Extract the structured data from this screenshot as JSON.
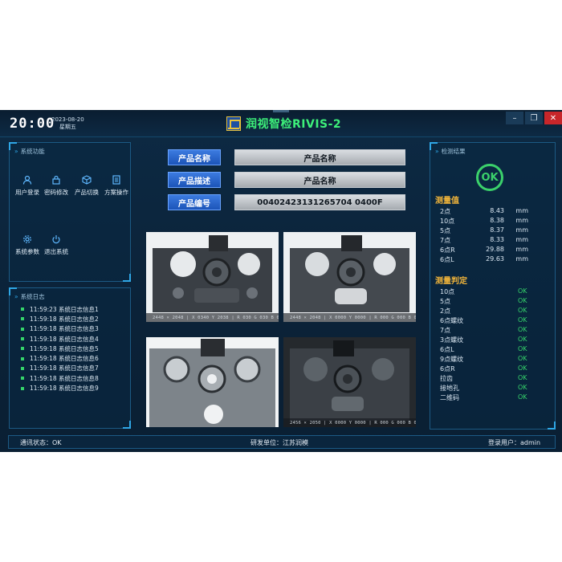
{
  "header": {
    "clock": "20:00",
    "date": "2023-08-20",
    "weekday": "星期五",
    "title": "润视智检RIVIS-2",
    "window_buttons": [
      "minimize-icon",
      "restore-icon",
      "close-icon"
    ]
  },
  "functions": {
    "title": "系统功能",
    "items": [
      {
        "label": "用户登录",
        "icon": "user-icon"
      },
      {
        "label": "密码修改",
        "icon": "lock-icon"
      },
      {
        "label": "产品切换",
        "icon": "cube-icon"
      },
      {
        "label": "方案操作",
        "icon": "document-icon"
      },
      {
        "label": "系统参数",
        "icon": "gear-icon"
      },
      {
        "label": "退出系统",
        "icon": "power-icon"
      }
    ]
  },
  "log": {
    "title": "系统日志",
    "entries": [
      {
        "time": "11:59:23",
        "text": "系统日志信息1"
      },
      {
        "time": "11:59:18",
        "text": "系统日志信息2"
      },
      {
        "time": "11:59:18",
        "text": "系统日志信息3"
      },
      {
        "time": "11:59:18",
        "text": "系统日志信息4"
      },
      {
        "time": "11:59:18",
        "text": "系统日志信息5"
      },
      {
        "time": "11:59:18",
        "text": "系统日志信息6"
      },
      {
        "time": "11:59:18",
        "text": "系统日志信息7"
      },
      {
        "time": "11:59:18",
        "text": "系统日志信息8"
      },
      {
        "time": "11:59:18",
        "text": "系统日志信息9"
      }
    ]
  },
  "product": {
    "name_label": "产品名称",
    "name_value": "产品名称",
    "desc_label": "产品描述",
    "desc_value": "产品名称",
    "code_label": "产品编号",
    "code_value": "00402423131265704 0400F"
  },
  "cameras": [
    {
      "info": "2448 × 2048  |  X 0340 Y 2038  |  R 030 G 030 B 030"
    },
    {
      "info": "2448 × 2048  |  X 0000 Y 0000  |  R 000 G 000 B 000"
    },
    {
      "info": ""
    },
    {
      "info": "2456 × 2050  |  X 0000 Y 0000  |  R 000 G 000 B 000"
    }
  ],
  "results": {
    "title": "检测结果",
    "overall": "OK",
    "overall_color": "#3bd16b",
    "measure_title": "测量值",
    "measurements": [
      {
        "name": "2点",
        "value": "8.43",
        "unit": "mm"
      },
      {
        "name": "10点",
        "value": "8.38",
        "unit": "mm"
      },
      {
        "name": "5点",
        "value": "8.37",
        "unit": "mm"
      },
      {
        "name": "7点",
        "value": "8.33",
        "unit": "mm"
      },
      {
        "name": "6点R",
        "value": "29.88",
        "unit": "mm"
      },
      {
        "name": "6点L",
        "value": "29.63",
        "unit": "mm"
      }
    ],
    "judge_title": "测量判定",
    "judgements": [
      {
        "name": "10点",
        "result": "OK"
      },
      {
        "name": "5点",
        "result": "OK"
      },
      {
        "name": "2点",
        "result": "OK"
      },
      {
        "name": "6点螺纹",
        "result": "OK"
      },
      {
        "name": "7点",
        "result": "OK"
      },
      {
        "name": "3点螺纹",
        "result": "OK"
      },
      {
        "name": "6点L",
        "result": "OK"
      },
      {
        "name": "9点螺纹",
        "result": "OK"
      },
      {
        "name": "6点R",
        "result": "OK"
      },
      {
        "name": "拉齿",
        "result": "OK"
      },
      {
        "name": "接地孔",
        "result": "OK"
      },
      {
        "name": "二维码",
        "result": "OK"
      }
    ]
  },
  "status": {
    "comm": "通讯状态：OK",
    "dev": "研发单位：江苏润模",
    "user": "登录用户：admin"
  }
}
